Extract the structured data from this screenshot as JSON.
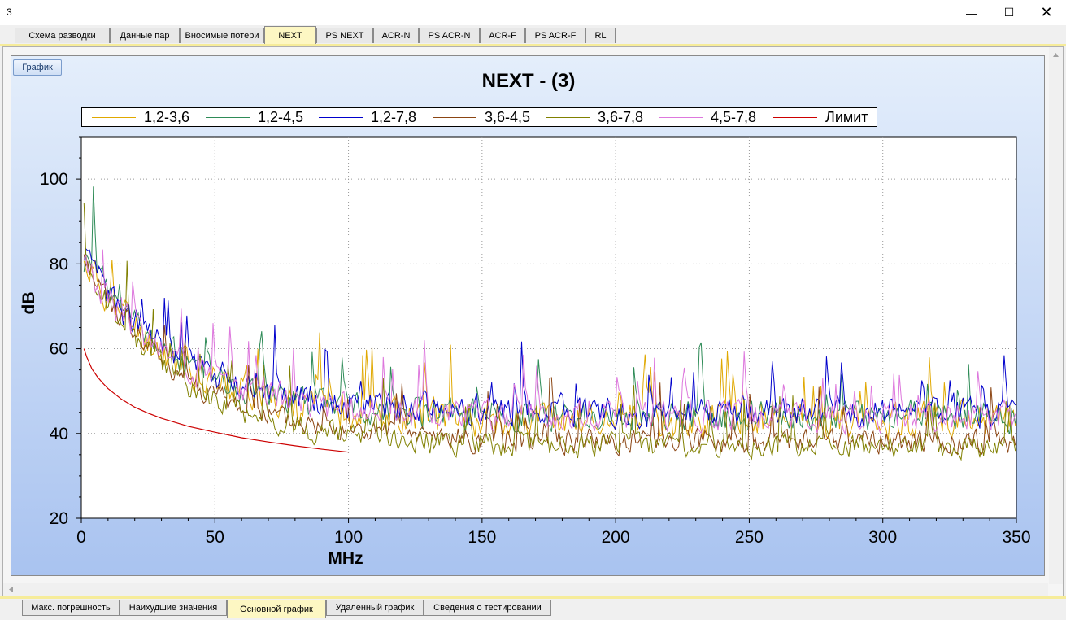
{
  "window": {
    "title": "3",
    "minimize_icon": "minimize-icon",
    "maximize_icon": "maximize-icon",
    "close_icon": "close-icon"
  },
  "top_tabs": [
    {
      "label": "Схема разводки",
      "active": false
    },
    {
      "label": "Данные пар",
      "active": false
    },
    {
      "label": "Вносимые потери",
      "active": false
    },
    {
      "label": "NEXT",
      "active": true
    },
    {
      "label": "PS NEXT",
      "active": false
    },
    {
      "label": "ACR-N",
      "active": false
    },
    {
      "label": "PS ACR-N",
      "active": false
    },
    {
      "label": "ACR-F",
      "active": false
    },
    {
      "label": "PS ACR-F",
      "active": false
    },
    {
      "label": "RL",
      "active": false
    }
  ],
  "toolbar": {
    "graph_button": "График"
  },
  "bottom_tabs": [
    {
      "label": "Макс. погрешность",
      "active": false
    },
    {
      "label": "Наихудшие значения",
      "active": false
    },
    {
      "label": "Основной график",
      "active": true
    },
    {
      "label": "Удаленный график",
      "active": false
    },
    {
      "label": "Сведения о тестировании",
      "active": false
    }
  ],
  "chart_data": {
    "type": "line",
    "title": "NEXT - (3)",
    "xlabel": "MHz",
    "ylabel": "dB",
    "xlim": [
      0,
      350
    ],
    "ylim": [
      20,
      110
    ],
    "x_ticks": [
      0,
      50,
      100,
      150,
      200,
      250,
      300,
      350
    ],
    "y_ticks": [
      20,
      40,
      60,
      80,
      100
    ],
    "grid": true,
    "legend_position": "top",
    "series": [
      {
        "name": "1,2-3,6",
        "color": "#e0a800",
        "seed": 11,
        "base": 57,
        "tail": 43,
        "amp": 6,
        "spike": 0.06
      },
      {
        "name": "1,2-4,5",
        "color": "#2e8b57",
        "seed": 23,
        "base": 58,
        "tail": 44,
        "amp": 5,
        "spike": 0.05
      },
      {
        "name": "1,2-7,8",
        "color": "#0000cc",
        "seed": 37,
        "base": 57,
        "tail": 45,
        "amp": 5,
        "spike": 0.06
      },
      {
        "name": "3,6-4,5",
        "color": "#8b4513",
        "seed": 41,
        "base": 58,
        "tail": 38,
        "amp": 4,
        "spike": 0.05
      },
      {
        "name": "3,6-7,8",
        "color": "#808000",
        "seed": 53,
        "base": 56,
        "tail": 37,
        "amp": 4,
        "spike": 0.05
      },
      {
        "name": "4,5-7,8",
        "color": "#dd77dd",
        "seed": 67,
        "base": 56,
        "tail": 44,
        "amp": 5,
        "spike": 0.05
      },
      {
        "name": "Лимит",
        "color": "#cc0000",
        "limit": true
      }
    ],
    "limit_curve": {
      "x": [
        1,
        2,
        4,
        6,
        8,
        10,
        15,
        20,
        25,
        30,
        40,
        50,
        60,
        70,
        80,
        90,
        100
      ],
      "y": [
        60.0,
        58.1,
        55.2,
        53.4,
        51.9,
        50.6,
        48.1,
        46.2,
        44.8,
        43.6,
        41.7,
        40.3,
        39.0,
        38.0,
        37.1,
        36.3,
        35.6
      ]
    }
  }
}
